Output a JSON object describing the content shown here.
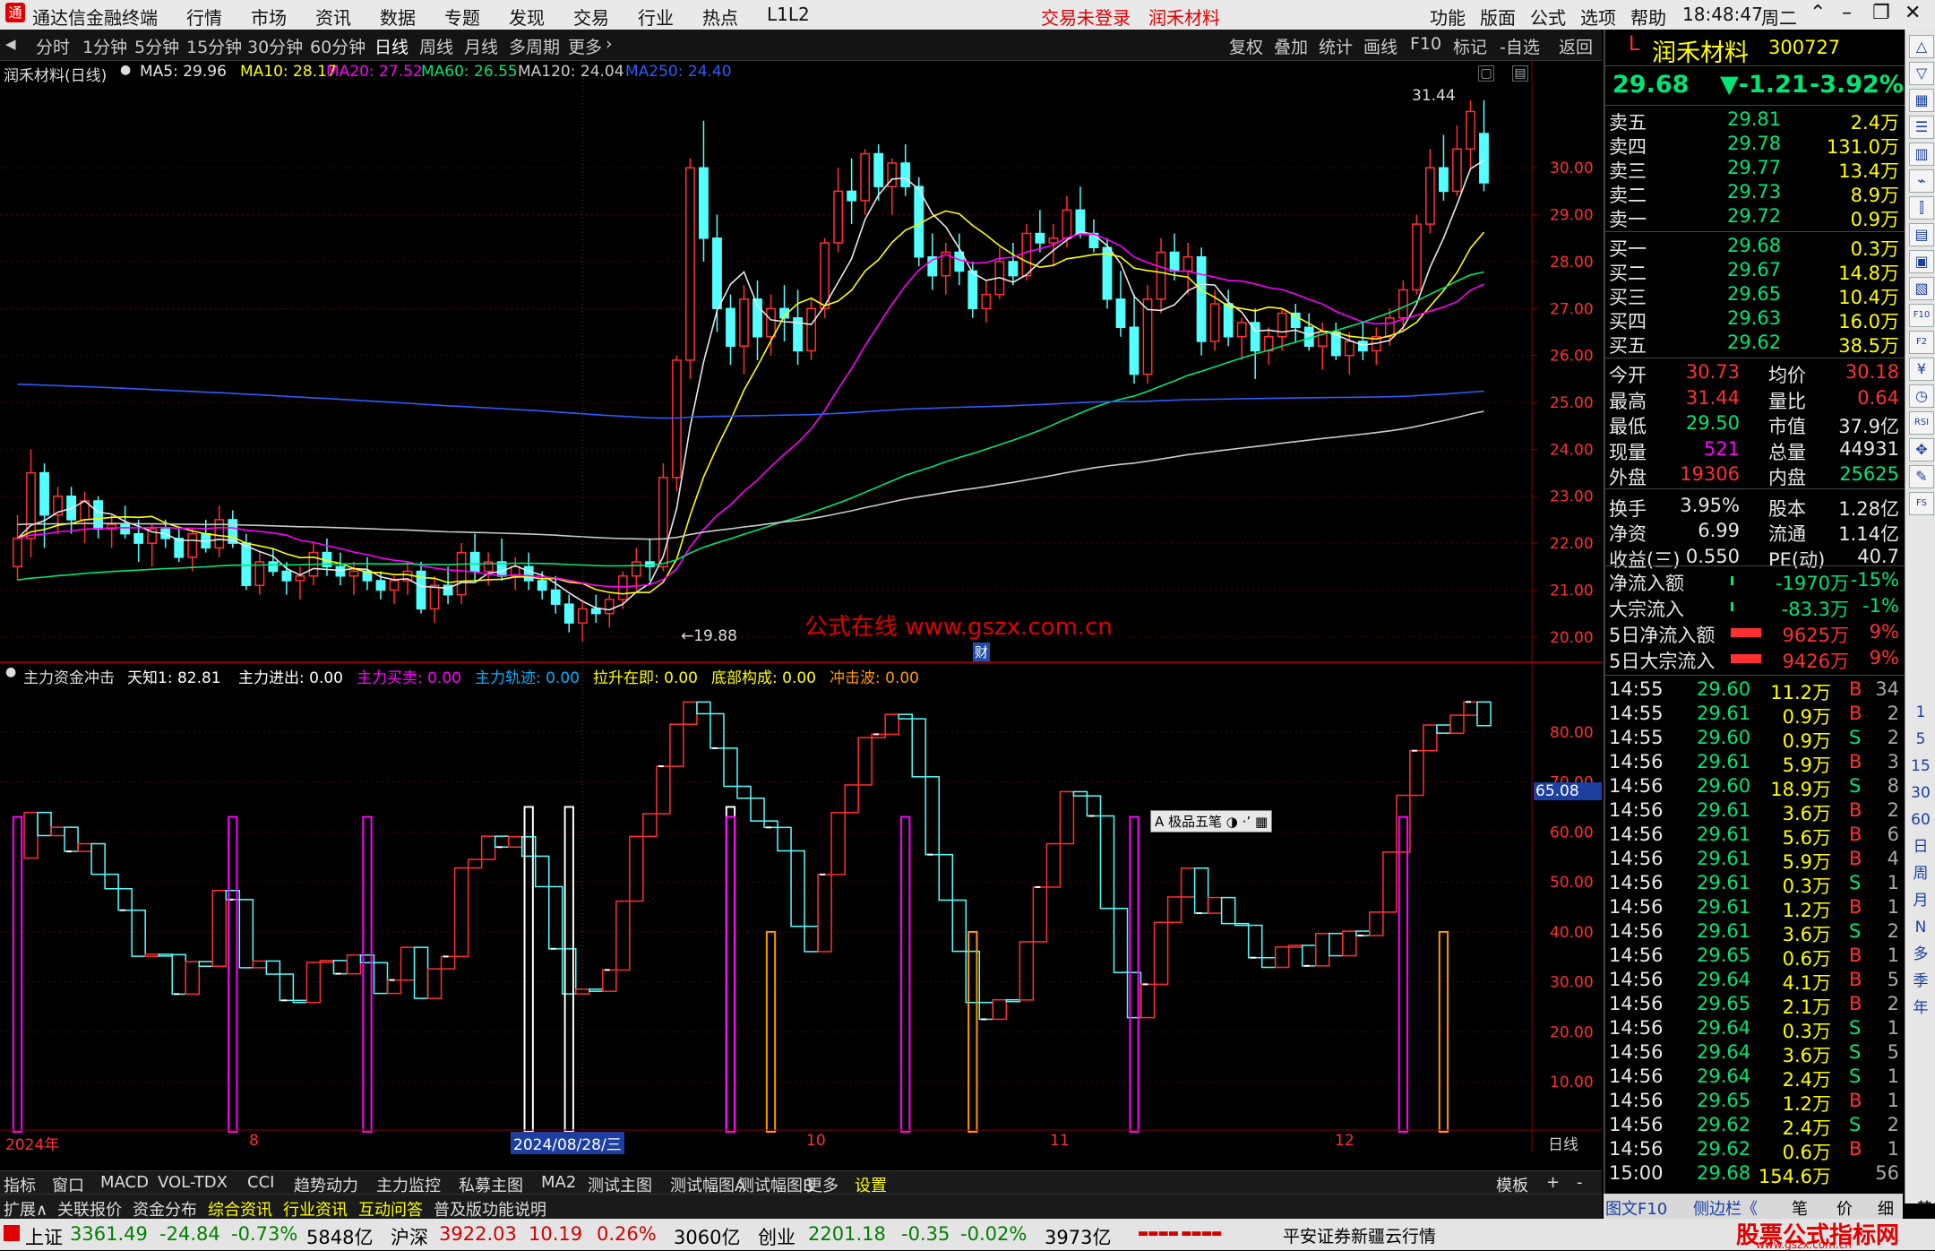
{
  "menubar": {
    "app_title": "通达信金融终端",
    "menus": [
      "行情",
      "市场",
      "资讯",
      "数据",
      "专题",
      "发现",
      "交易",
      "行业",
      "热点",
      "L1L2"
    ],
    "notice_trade": "交易未登录",
    "notice_stock": "润禾材料",
    "right_menus": [
      "功能",
      "版面",
      "公式",
      "选项",
      "帮助"
    ],
    "clock": "18:48:47",
    "weekday": "周二"
  },
  "period_bar": {
    "items": [
      "分时",
      "1分钟",
      "5分钟",
      "15分钟",
      "30分钟",
      "60分钟",
      "日线",
      "周线",
      "月线",
      "多周期",
      "更多"
    ],
    "active": "日线",
    "tools": [
      "复权",
      "叠加",
      "统计",
      "画线",
      "F10",
      "标记",
      "-自选",
      "返回"
    ]
  },
  "main_chart": {
    "legend_name": "润禾材料(日线)",
    "ma": [
      {
        "label": "MA5: 29.96",
        "color": "#e8e8e8"
      },
      {
        "label": "MA10: 28.17",
        "color": "#ffff00"
      },
      {
        "label": "MA20: 27.52",
        "color": "#ff00ff"
      },
      {
        "label": "MA60: 26.55",
        "color": "#00e676"
      },
      {
        "label": "MA120: 24.04",
        "color": "#cccccc"
      },
      {
        "label": "MA250: 24.40",
        "color": "#2b5cff"
      }
    ],
    "high_label": "31.44",
    "low_label": "←19.88",
    "watermark": "公式在线  www.gszx.com.cn",
    "cai_badge": "财",
    "y_ticks": [
      "30.00",
      "29.00",
      "28.00",
      "27.00",
      "26.00",
      "25.00",
      "24.00",
      "23.00",
      "22.00",
      "21.00",
      "20.00"
    ],
    "y_range": [
      19.5,
      31.8
    ]
  },
  "sub_chart": {
    "indicator": "主力资金冲击",
    "values": [
      {
        "label": "天知1: 82.81",
        "color": "#ffffff"
      },
      {
        "label": "主力进出: 0.00",
        "color": "#ffffff"
      },
      {
        "label": "主力买卖: 0.00",
        "color": "#ff00ff"
      },
      {
        "label": "主力轨迹: 0.00",
        "color": "#00b0ff"
      },
      {
        "label": "拉升在即: 0.00",
        "color": "#ffff00"
      },
      {
        "label": "底部构成: 0.00",
        "color": "#ffff00"
      },
      {
        "label": "冲击波: 0.00",
        "color": "#ff9900"
      }
    ],
    "y_ticks": [
      "80.00",
      "70.00",
      "60.00",
      "50.00",
      "40.00",
      "30.00",
      "20.00",
      "10.00"
    ],
    "current_value": "65.08",
    "y_range": [
      0,
      90
    ],
    "popup_label": "A 极品五笔"
  },
  "x_axis": {
    "labels": [
      "2024年",
      "8",
      "2024/08/28/三",
      "10",
      "11",
      "12"
    ],
    "period": "日线"
  },
  "chart_data": {
    "type": "candlestick",
    "candles": [
      [
        21.5,
        22.6,
        21.2,
        22.1
      ],
      [
        22.1,
        24.0,
        21.7,
        23.5
      ],
      [
        23.5,
        23.7,
        21.9,
        22.6
      ],
      [
        22.6,
        23.2,
        22.2,
        23.0
      ],
      [
        23.0,
        23.2,
        22.2,
        22.5
      ],
      [
        22.5,
        23.1,
        22.0,
        22.9
      ],
      [
        22.9,
        23.0,
        22.1,
        22.3
      ],
      [
        22.3,
        22.6,
        21.9,
        22.4
      ],
      [
        22.4,
        22.8,
        22.1,
        22.2
      ],
      [
        22.2,
        22.5,
        21.6,
        22.0
      ],
      [
        22.0,
        22.4,
        21.5,
        22.3
      ],
      [
        22.3,
        22.5,
        21.9,
        22.1
      ],
      [
        22.1,
        22.3,
        21.6,
        21.7
      ],
      [
        21.7,
        22.3,
        21.4,
        22.2
      ],
      [
        22.2,
        22.5,
        21.8,
        21.9
      ],
      [
        21.9,
        22.8,
        21.7,
        22.5
      ],
      [
        22.5,
        22.7,
        21.9,
        22.0
      ],
      [
        22.0,
        22.2,
        21.0,
        21.1
      ],
      [
        21.1,
        21.8,
        20.9,
        21.6
      ],
      [
        21.6,
        21.9,
        21.3,
        21.4
      ],
      [
        21.4,
        21.6,
        20.9,
        21.2
      ],
      [
        21.2,
        21.5,
        20.8,
        21.3
      ],
      [
        21.3,
        22.0,
        21.1,
        21.8
      ],
      [
        21.8,
        22.1,
        21.3,
        21.5
      ],
      [
        21.5,
        21.8,
        21.1,
        21.3
      ],
      [
        21.3,
        21.6,
        20.9,
        21.4
      ],
      [
        21.4,
        21.7,
        21.0,
        21.2
      ],
      [
        21.2,
        21.4,
        20.8,
        21.0
      ],
      [
        21.0,
        21.3,
        20.7,
        21.2
      ],
      [
        21.2,
        21.6,
        20.9,
        21.4
      ],
      [
        21.4,
        21.6,
        20.5,
        20.6
      ],
      [
        20.6,
        21.3,
        20.3,
        21.1
      ],
      [
        21.1,
        21.5,
        20.7,
        20.9
      ],
      [
        20.9,
        22.0,
        20.7,
        21.8
      ],
      [
        21.8,
        22.2,
        21.2,
        21.4
      ],
      [
        21.4,
        21.8,
        21.1,
        21.6
      ],
      [
        21.6,
        22.1,
        21.2,
        21.3
      ],
      [
        21.3,
        21.7,
        21.0,
        21.5
      ],
      [
        21.5,
        21.8,
        21.0,
        21.2
      ],
      [
        21.2,
        21.4,
        20.8,
        21.0
      ],
      [
        21.0,
        21.3,
        20.5,
        20.7
      ],
      [
        20.7,
        20.9,
        20.1,
        20.3
      ],
      [
        20.3,
        20.8,
        19.9,
        20.6
      ],
      [
        20.6,
        20.9,
        20.3,
        20.5
      ],
      [
        20.5,
        20.9,
        20.2,
        20.8
      ],
      [
        20.8,
        21.4,
        20.6,
        21.3
      ],
      [
        21.3,
        21.9,
        21.0,
        21.6
      ],
      [
        21.6,
        22.1,
        21.2,
        21.5
      ],
      [
        21.5,
        23.7,
        21.4,
        23.4
      ],
      [
        23.4,
        26.0,
        23.1,
        25.9
      ],
      [
        25.9,
        30.2,
        25.5,
        30.0
      ],
      [
        30.0,
        31.0,
        28.0,
        28.5
      ],
      [
        28.5,
        29.0,
        26.5,
        27.0
      ],
      [
        27.0,
        27.3,
        25.8,
        26.2
      ],
      [
        26.2,
        27.5,
        25.6,
        27.2
      ],
      [
        27.2,
        27.6,
        25.9,
        26.4
      ],
      [
        26.4,
        27.3,
        26.0,
        27.0
      ],
      [
        27.0,
        27.5,
        26.3,
        26.8
      ],
      [
        26.8,
        27.4,
        25.8,
        26.1
      ],
      [
        26.1,
        27.2,
        25.9,
        27.0
      ],
      [
        27.0,
        28.5,
        26.8,
        28.4
      ],
      [
        28.4,
        30.0,
        28.2,
        29.5
      ],
      [
        29.5,
        30.2,
        28.8,
        29.3
      ],
      [
        29.3,
        30.4,
        29.0,
        30.3
      ],
      [
        30.3,
        30.5,
        29.3,
        29.6
      ],
      [
        29.6,
        30.2,
        29.0,
        30.1
      ],
      [
        30.1,
        30.5,
        29.4,
        29.6
      ],
      [
        29.6,
        29.8,
        27.9,
        28.1
      ],
      [
        28.1,
        28.6,
        27.4,
        27.7
      ],
      [
        27.7,
        28.4,
        27.3,
        28.2
      ],
      [
        28.2,
        28.6,
        27.5,
        27.8
      ],
      [
        27.8,
        28.0,
        26.8,
        27.0
      ],
      [
        27.0,
        27.6,
        26.7,
        27.3
      ],
      [
        27.3,
        28.3,
        27.2,
        28.0
      ],
      [
        28.0,
        28.4,
        27.5,
        27.7
      ],
      [
        27.7,
        28.8,
        27.6,
        28.6
      ],
      [
        28.6,
        29.1,
        28.2,
        28.4
      ],
      [
        28.4,
        28.8,
        27.9,
        28.5
      ],
      [
        28.5,
        29.4,
        28.3,
        29.1
      ],
      [
        29.1,
        29.6,
        28.5,
        28.6
      ],
      [
        28.6,
        28.9,
        28.2,
        28.3
      ],
      [
        28.3,
        28.5,
        27.0,
        27.2
      ],
      [
        27.2,
        27.8,
        26.4,
        26.6
      ],
      [
        26.6,
        27.3,
        25.4,
        25.6
      ],
      [
        25.6,
        27.5,
        25.4,
        27.2
      ],
      [
        27.2,
        28.5,
        26.9,
        28.2
      ],
      [
        28.2,
        28.6,
        27.6,
        27.8
      ],
      [
        27.8,
        28.4,
        27.3,
        28.1
      ],
      [
        28.1,
        28.3,
        26.0,
        26.3
      ],
      [
        26.3,
        27.4,
        26.1,
        27.1
      ],
      [
        27.1,
        27.4,
        26.2,
        26.4
      ],
      [
        26.4,
        26.8,
        25.9,
        26.7
      ],
      [
        26.7,
        27.0,
        25.5,
        26.1
      ],
      [
        26.1,
        26.6,
        25.8,
        26.4
      ],
      [
        26.4,
        27.0,
        26.1,
        26.9
      ],
      [
        26.9,
        27.1,
        26.3,
        26.6
      ],
      [
        26.6,
        26.9,
        26.1,
        26.2
      ],
      [
        26.2,
        26.7,
        25.7,
        26.5
      ],
      [
        26.5,
        26.7,
        25.9,
        26.0
      ],
      [
        26.0,
        26.5,
        25.6,
        26.3
      ],
      [
        26.3,
        26.7,
        25.9,
        26.1
      ],
      [
        26.1,
        26.6,
        25.8,
        26.4
      ],
      [
        26.4,
        27.0,
        26.2,
        26.8
      ],
      [
        26.8,
        27.6,
        26.5,
        27.4
      ],
      [
        27.4,
        29.0,
        27.3,
        28.8
      ],
      [
        28.8,
        30.4,
        28.6,
        30.0
      ],
      [
        30.0,
        30.7,
        29.3,
        29.5
      ],
      [
        29.5,
        30.9,
        29.4,
        30.4
      ],
      [
        30.4,
        31.44,
        30.0,
        31.2
      ],
      [
        30.73,
        31.44,
        29.5,
        29.68
      ]
    ]
  },
  "quote": {
    "name": "润禾材料",
    "code": "300727",
    "price": "29.68",
    "change": "▼-1.21",
    "pct": "-3.92%",
    "asks": [
      {
        "label": "卖五",
        "price": "29.81",
        "vol": "2.4万"
      },
      {
        "label": "卖四",
        "price": "29.78",
        "vol": "131.0万"
      },
      {
        "label": "卖三",
        "price": "29.77",
        "vol": "13.4万"
      },
      {
        "label": "卖二",
        "price": "29.73",
        "vol": "8.9万"
      },
      {
        "label": "卖一",
        "price": "29.72",
        "vol": "0.9万"
      }
    ],
    "bids": [
      {
        "label": "买一",
        "price": "29.68",
        "vol": "0.3万"
      },
      {
        "label": "买二",
        "price": "29.67",
        "vol": "14.8万"
      },
      {
        "label": "买三",
        "price": "29.65",
        "vol": "10.4万"
      },
      {
        "label": "买四",
        "price": "29.63",
        "vol": "16.0万"
      },
      {
        "label": "买五",
        "price": "29.62",
        "vol": "38.5万"
      }
    ],
    "stats": [
      {
        "k1": "今开",
        "v1": "30.73",
        "c1": "red",
        "k2": "均价",
        "v2": "30.18",
        "c2": "red"
      },
      {
        "k1": "最高",
        "v1": "31.44",
        "c1": "red",
        "k2": "量比",
        "v2": "0.64",
        "c2": "red"
      },
      {
        "k1": "最低",
        "v1": "29.50",
        "c1": "green",
        "k2": "市值",
        "v2": "37.9亿",
        "c2": "white"
      },
      {
        "k1": "现量",
        "v1": "521",
        "c1": "mag",
        "k2": "总量",
        "v2": "44931",
        "c2": "white"
      },
      {
        "k1": "外盘",
        "v1": "19306",
        "c1": "red",
        "k2": "内盘",
        "v2": "25625",
        "c2": "green"
      },
      {
        "k1": "换手",
        "v1": "3.95%",
        "c1": "white",
        "k2": "股本",
        "v2": "1.28亿",
        "c2": "white"
      },
      {
        "k1": "净资",
        "v1": "6.99",
        "c1": "white",
        "k2": "流通",
        "v2": "1.14亿",
        "c2": "white"
      },
      {
        "k1": "收益(三)",
        "v1": "0.550",
        "c1": "white",
        "k2": "PE(动)",
        "v2": "40.7",
        "c2": "white"
      }
    ],
    "flows": [
      {
        "k": "净流入额",
        "v": "-1970万",
        "p": "-15%",
        "c": "green"
      },
      {
        "k": "大宗流入",
        "v": "-83.3万",
        "p": "-1%",
        "c": "green"
      },
      {
        "k": "5日净流入额",
        "v": "9625万",
        "p": "9%",
        "c": "red"
      },
      {
        "k": "5日大宗流入",
        "v": "9426万",
        "p": "9%",
        "c": "red"
      }
    ],
    "ticks": [
      {
        "t": "14:55",
        "p": "29.60",
        "v": "11.2万",
        "d": "B",
        "n": "34"
      },
      {
        "t": "14:55",
        "p": "29.61",
        "v": "0.9万",
        "d": "B",
        "n": "2"
      },
      {
        "t": "14:55",
        "p": "29.60",
        "v": "0.9万",
        "d": "S",
        "n": "2"
      },
      {
        "t": "14:56",
        "p": "29.61",
        "v": "5.9万",
        "d": "B",
        "n": "3"
      },
      {
        "t": "14:56",
        "p": "29.60",
        "v": "18.9万",
        "d": "S",
        "n": "8"
      },
      {
        "t": "14:56",
        "p": "29.61",
        "v": "3.6万",
        "d": "B",
        "n": "2"
      },
      {
        "t": "14:56",
        "p": "29.61",
        "v": "5.6万",
        "d": "B",
        "n": "6"
      },
      {
        "t": "14:56",
        "p": "29.61",
        "v": "5.9万",
        "d": "B",
        "n": "4"
      },
      {
        "t": "14:56",
        "p": "29.61",
        "v": "0.3万",
        "d": "S",
        "n": "1"
      },
      {
        "t": "14:56",
        "p": "29.61",
        "v": "1.2万",
        "d": "B",
        "n": "1"
      },
      {
        "t": "14:56",
        "p": "29.61",
        "v": "3.6万",
        "d": "S",
        "n": "2"
      },
      {
        "t": "14:56",
        "p": "29.65",
        "v": "0.6万",
        "d": "B",
        "n": "1"
      },
      {
        "t": "14:56",
        "p": "29.64",
        "v": "4.1万",
        "d": "B",
        "n": "5"
      },
      {
        "t": "14:56",
        "p": "29.65",
        "v": "2.1万",
        "d": "B",
        "n": "2"
      },
      {
        "t": "14:56",
        "p": "29.64",
        "v": "0.3万",
        "d": "S",
        "n": "1"
      },
      {
        "t": "14:56",
        "p": "29.64",
        "v": "3.6万",
        "d": "S",
        "n": "5"
      },
      {
        "t": "14:56",
        "p": "29.64",
        "v": "2.4万",
        "d": "S",
        "n": "1"
      },
      {
        "t": "14:56",
        "p": "29.65",
        "v": "1.2万",
        "d": "B",
        "n": "1"
      },
      {
        "t": "14:56",
        "p": "29.62",
        "v": "2.4万",
        "d": "S",
        "n": "2"
      },
      {
        "t": "14:56",
        "p": "29.62",
        "v": "0.6万",
        "d": "B",
        "n": "1"
      },
      {
        "t": "15:00",
        "p": "29.68",
        "v": "154.6万",
        "d": "",
        "n": "56"
      }
    ]
  },
  "bottom_tabs1": [
    "指标",
    "窗口",
    "MACD",
    "VOL-TDX",
    "CCI",
    "趋势动力",
    "主力监控",
    "私募主图",
    "MA2",
    "测试主图",
    "测试幅图A",
    "测试幅图B",
    "更多",
    "设置"
  ],
  "bottom_tabs1_right": [
    "模板",
    "+",
    "-"
  ],
  "bottom_tabs2": [
    {
      "label": "扩展∧",
      "color": "#dddddd"
    },
    {
      "label": "关联报价",
      "color": "#dddddd"
    },
    {
      "label": "资金分布",
      "color": "#dddddd"
    },
    {
      "label": "综合资讯",
      "color": "#ffff00"
    },
    {
      "label": "行业资讯",
      "color": "#ffff00"
    },
    {
      "label": "互动问答",
      "color": "#ffff00"
    },
    {
      "label": "普及版功能说明",
      "color": "#dddddd"
    }
  ],
  "rp_bottom": [
    "图文F10",
    "侧边栏《",
    "笔",
    "价",
    "细",
    "势"
  ],
  "status": {
    "idx1_name": "上证",
    "idx1_val": "3361.49",
    "idx1_chg": "-24.84",
    "idx1_pct": "-0.73%",
    "idx1_amt": "5848亿",
    "idx2_name": "沪深",
    "idx2_val": "3922.03",
    "idx2_chg": "10.19",
    "idx2_pct": "0.26%",
    "idx2_amt": "3060亿",
    "idx3_name": "创业",
    "idx3_val": "2201.18",
    "idx3_chg": "-0.35",
    "idx3_pct": "-0.02%",
    "idx3_amt": "3973亿",
    "broker": "平安证券新疆云行情",
    "brand": "股票公式指标网",
    "brand_url": "www.gszx.com.cn"
  },
  "sidebar_icons": [
    "up-arrow-icon",
    "down-arrow-icon",
    "grid-icon",
    "list-icon",
    "bars-icon",
    "chart-icon",
    "candle-icon",
    "doc-icon",
    "fin-icon",
    "table-icon",
    "f10-icon",
    "f2-icon",
    "money-icon",
    "clock-icon",
    "rsi-icon",
    "move-icon",
    "pen-icon",
    "fs-icon"
  ],
  "sidebar_labels": [
    "1",
    "5",
    "15",
    "30",
    "60",
    "日",
    "周",
    "月",
    "N",
    "多",
    "季",
    "年"
  ]
}
